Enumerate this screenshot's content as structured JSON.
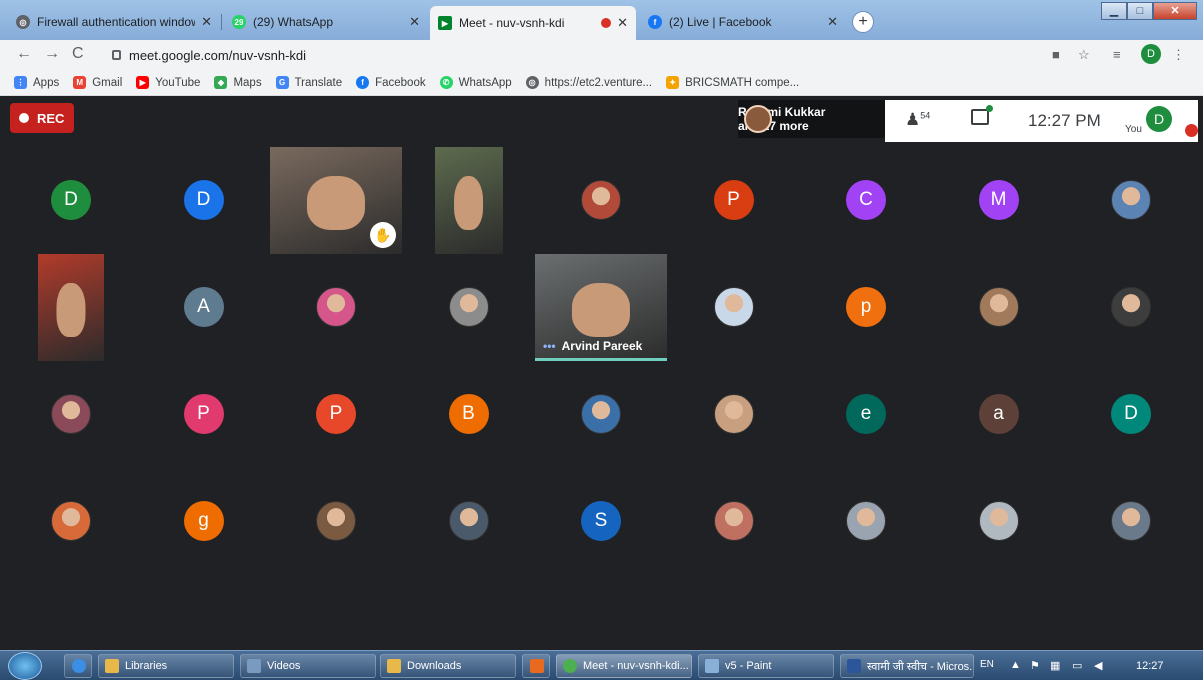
{
  "browser": {
    "tabs": [
      {
        "title": "Firewall authentication window h",
        "icon": "globe-icon",
        "color": "#5f6368"
      },
      {
        "title": "(29) WhatsApp",
        "icon": "whatsapp-icon",
        "color": "#25d366",
        "badge": "29"
      },
      {
        "title": "Meet - nuv-vsnh-kdi",
        "icon": "meet-icon",
        "color": "#00832d",
        "active": true
      },
      {
        "title": "(2) Live | Facebook",
        "icon": "facebook-icon",
        "color": "#1877f2"
      }
    ],
    "url": "meet.google.com/nuv-vsnh-kdi",
    "profile_initial": "D",
    "bookmarks": [
      {
        "label": "Apps",
        "icon": "apps-grid-icon",
        "color": "#4285f4"
      },
      {
        "label": "Gmail",
        "icon": "gmail-icon",
        "color": "#ea4335"
      },
      {
        "label": "YouTube",
        "icon": "youtube-icon",
        "color": "#ff0000"
      },
      {
        "label": "Maps",
        "icon": "maps-icon",
        "color": "#34a853"
      },
      {
        "label": "Translate",
        "icon": "translate-icon",
        "color": "#4285f4"
      },
      {
        "label": "Facebook",
        "icon": "facebook-icon",
        "color": "#1877f2"
      },
      {
        "label": "WhatsApp",
        "icon": "whatsapp-icon",
        "color": "#25d366"
      },
      {
        "label": "https://etc2.venture...",
        "icon": "globe-icon",
        "color": "#5f6368"
      },
      {
        "label": "BRICSMATH compe...",
        "icon": "bricsmath-icon",
        "color": "#f4a300"
      }
    ]
  },
  "meet": {
    "rec_label": "REC",
    "presenter": {
      "line1": "Rashmi Kukkar",
      "line2": "and 17 more"
    },
    "participant_count": "54",
    "time": "12:27 PM",
    "you_label": "You",
    "you_initial": "D",
    "named_video": "Arvind Pareek",
    "participants": [
      {
        "row": 0,
        "col": 0,
        "initial": "D",
        "color": "#1e8e3e"
      },
      {
        "row": 0,
        "col": 1,
        "initial": "D",
        "color": "#1a73e8"
      },
      {
        "row": 0,
        "col": 2,
        "video": true,
        "hand": true,
        "color": "#7a6a5e"
      },
      {
        "row": 0,
        "col": 3,
        "video": true,
        "color": "#5d6b4e"
      },
      {
        "row": 0,
        "col": 4,
        "photo": true,
        "color": "#b24a3a"
      },
      {
        "row": 0,
        "col": 5,
        "initial": "P",
        "color": "#d93e12"
      },
      {
        "row": 0,
        "col": 6,
        "initial": "C",
        "color": "#a142f4"
      },
      {
        "row": 0,
        "col": 7,
        "initial": "M",
        "color": "#a142f4"
      },
      {
        "row": 0,
        "col": 8,
        "photo": true,
        "color": "#5b84b5"
      },
      {
        "row": 1,
        "col": 0,
        "video": true,
        "color": "#b23b2b"
      },
      {
        "row": 1,
        "col": 1,
        "initial": "A",
        "color": "#5f7b8f"
      },
      {
        "row": 1,
        "col": 2,
        "photo": true,
        "color": "#d4568a"
      },
      {
        "row": 1,
        "col": 3,
        "photo": true,
        "color": "#8c8c8c"
      },
      {
        "row": 1,
        "col": 4,
        "video": true,
        "named": true,
        "color": "#6b6f70"
      },
      {
        "row": 1,
        "col": 5,
        "photo": true,
        "color": "#c9d8e8"
      },
      {
        "row": 1,
        "col": 6,
        "initial": "p",
        "color": "#f07010"
      },
      {
        "row": 1,
        "col": 7,
        "photo": true,
        "color": "#a07a5a"
      },
      {
        "row": 1,
        "col": 8,
        "photo": true,
        "color": "#3d3d3d"
      },
      {
        "row": 2,
        "col": 0,
        "photo": true,
        "color": "#8a4a5a"
      },
      {
        "row": 2,
        "col": 1,
        "initial": "P",
        "color": "#e03a6e"
      },
      {
        "row": 2,
        "col": 2,
        "initial": "P",
        "color": "#e8482a"
      },
      {
        "row": 2,
        "col": 3,
        "initial": "B",
        "color": "#ef6c00"
      },
      {
        "row": 2,
        "col": 4,
        "photo": true,
        "color": "#3a6fa8"
      },
      {
        "row": 2,
        "col": 5,
        "photo": true,
        "color": "#c8a080"
      },
      {
        "row": 2,
        "col": 6,
        "initial": "e",
        "color": "#00695c"
      },
      {
        "row": 2,
        "col": 7,
        "initial": "a",
        "color": "#5d4037"
      },
      {
        "row": 2,
        "col": 8,
        "initial": "D",
        "color": "#00897b"
      },
      {
        "row": 3,
        "col": 0,
        "photo": true,
        "color": "#d86a3a"
      },
      {
        "row": 3,
        "col": 1,
        "initial": "g",
        "color": "#ef6c00"
      },
      {
        "row": 3,
        "col": 2,
        "photo": true,
        "color": "#7a5a40"
      },
      {
        "row": 3,
        "col": 3,
        "photo": true,
        "color": "#4a5a6a"
      },
      {
        "row": 3,
        "col": 4,
        "initial": "S",
        "color": "#1565c0"
      },
      {
        "row": 3,
        "col": 5,
        "photo": true,
        "color": "#c07060"
      },
      {
        "row": 3,
        "col": 6,
        "photo": true,
        "color": "#9aa4b0"
      },
      {
        "row": 3,
        "col": 7,
        "photo": true,
        "color": "#b0b8c0"
      },
      {
        "row": 3,
        "col": 8,
        "photo": true,
        "color": "#6a7a8a"
      }
    ]
  },
  "taskbar": {
    "items": [
      {
        "label": "Libraries",
        "icon": "folder-icon",
        "color": "#e8b84a"
      },
      {
        "label": "Videos",
        "icon": "video-folder-icon",
        "color": "#7a9ac0"
      },
      {
        "label": "Downloads",
        "icon": "folder-icon",
        "color": "#e8b84a"
      },
      {
        "label": "",
        "icon": "media-player-icon",
        "color": "#e86a20"
      },
      {
        "label": "Meet - nuv-vsnh-kdi...",
        "icon": "chrome-icon",
        "color": "#4caf50",
        "active": true
      },
      {
        "label": "v5 - Paint",
        "icon": "paint-icon",
        "color": "#8ab0d8"
      },
      {
        "label": "स्वामी जी स्वीच - Micros...",
        "icon": "word-icon",
        "color": "#2b579a"
      }
    ],
    "lang": "EN",
    "time": "12:27"
  }
}
